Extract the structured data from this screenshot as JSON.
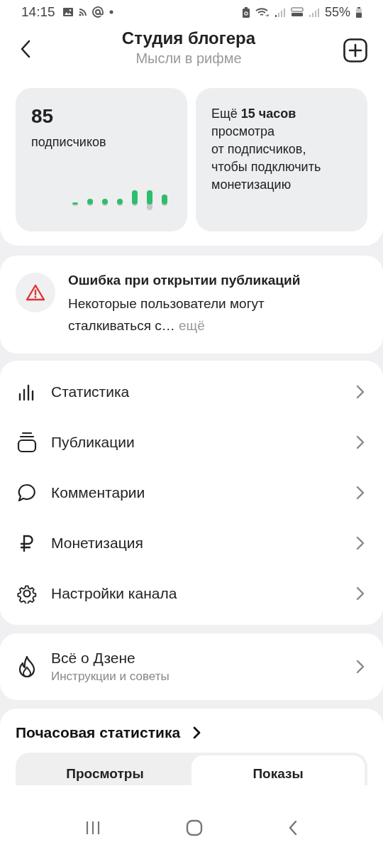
{
  "status_bar": {
    "time": "14:15",
    "battery": "55%"
  },
  "header": {
    "title": "Студия блогера",
    "subtitle": "Мысли в рифме"
  },
  "subscribers_card": {
    "count": "85",
    "label": "подписчиков"
  },
  "monetization_card": {
    "text": "Ещё **15 часов** просмотра\nот подписчиков,\nчтобы подключить\nмонетизацию"
  },
  "alert": {
    "title": "Ошибка при открытии публикаций",
    "text": "Некоторые пользователи могут сталкиваться с…",
    "more": "ещё"
  },
  "menu": [
    {
      "label": "Статистика"
    },
    {
      "label": "Публикации"
    },
    {
      "label": "Комментарии"
    },
    {
      "label": "Монетизация"
    },
    {
      "label": "Настройки канала"
    }
  ],
  "about": {
    "title": "Всё о Дзене",
    "subtitle": "Инструкции и советы"
  },
  "hourly_stats": {
    "title": "Почасовая статистика",
    "tabs": [
      {
        "label": "Просмотры",
        "selected": false
      },
      {
        "label": "Показы",
        "selected": true
      }
    ]
  }
}
